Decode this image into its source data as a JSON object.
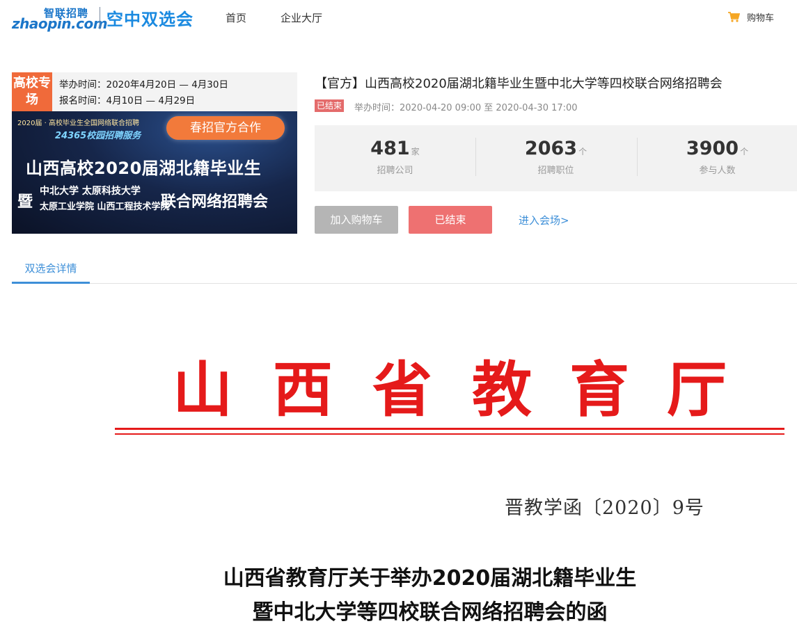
{
  "header": {
    "logo_top": "智联招聘",
    "logo_bottom": "zhaopin.com",
    "logo_sub": "空中双选会",
    "nav": [
      "首页",
      "企业大厅"
    ],
    "cart_label": "购物车",
    "cart_icon": "cart-icon"
  },
  "banner": {
    "tag": "高校专场",
    "line1": "举办时间：2020年4月20日 — 4月30日",
    "line2": "报名时间：4月10日 — 4月29日",
    "small": "2020届 · 高校毕业生全国网络联合招聘",
    "service": "24365校园招聘服务",
    "coop": "春招官方合作",
    "title": "山西高校2020届湖北籍毕业生",
    "ji": "暨",
    "uni1": "中北大学  太原科技大学",
    "uni2": "太原工业学院  山西工程技术学院",
    "joint": "联合网络招聘会"
  },
  "fair": {
    "title": "【官方】山西高校2020届湖北籍毕业生暨中北大学等四校联合网络招聘会",
    "status": "已结束",
    "time": "举办时间：2020-04-20 09:00 至 2020-04-30 17:00"
  },
  "stats": [
    {
      "value": "481",
      "unit": "家",
      "label": "招聘公司"
    },
    {
      "value": "2063",
      "unit": "个",
      "label": "招聘职位"
    },
    {
      "value": "3900",
      "unit": "个",
      "label": "参与人数"
    }
  ],
  "buttons": {
    "add_cart": "加入购物车",
    "ended": "已结束",
    "enter": "进入会场>"
  },
  "tabs": [
    "双选会详情"
  ],
  "document": {
    "header_chars": [
      "山",
      "西",
      "省",
      "教",
      "育",
      "厅"
    ],
    "number": "晋教学函〔2020〕9号",
    "title_line1": "山西省教育厅关于举办2020届湖北籍毕业生",
    "title_line2": "暨中北大学等四校联合网络招聘会的函"
  },
  "colors": {
    "accent": "#3d8fd8",
    "ended": "#ee7171",
    "document_red": "#e51a1a",
    "logo_blue": "#1b76c9"
  }
}
